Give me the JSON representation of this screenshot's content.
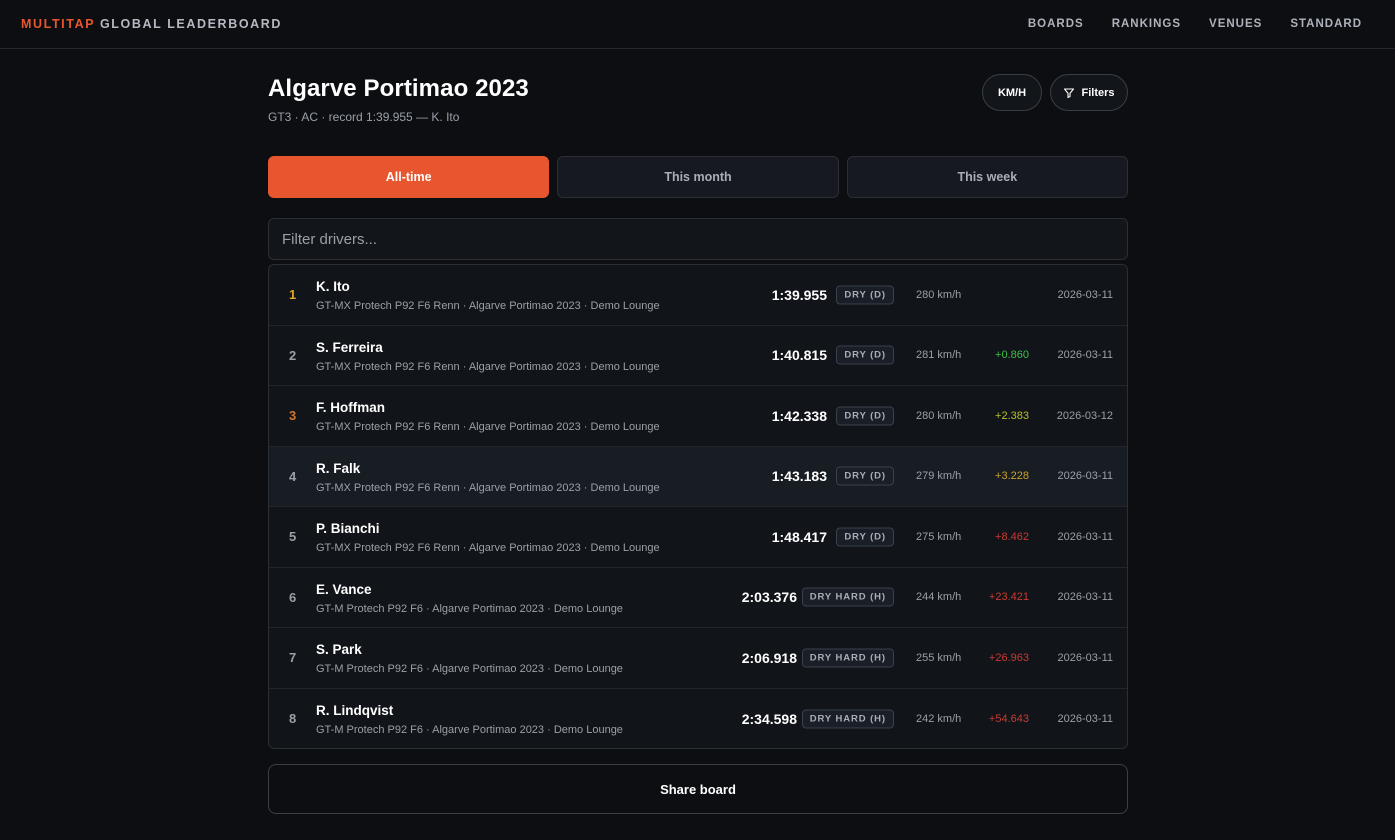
{
  "nav": {
    "brand_accent": "MULTITAP",
    "brand_rest": " GLOBAL LEADERBOARD",
    "links": [
      "BOARDS",
      "RANKINGS",
      "VENUES",
      "STANDARD"
    ]
  },
  "header": {
    "title": "Algarve Portimao 2023",
    "subtitle": "GT3 · AC · record 1:39.955 — K. Ito",
    "unit_toggle": "KM/H",
    "filters_label": "Filters"
  },
  "tabs": [
    {
      "label": "All-time",
      "active": true
    },
    {
      "label": "This month",
      "active": false
    },
    {
      "label": "This week",
      "active": false
    }
  ],
  "search": {
    "placeholder": "Filter drivers...",
    "value": ""
  },
  "rows": [
    {
      "pos": "1",
      "name": "K. Ito",
      "meta": "GT-MX Protech P92 F6 Renn · Algarve Portimao 2023 · Demo Lounge",
      "time": "1:39.955",
      "tyre": "DRY (D)",
      "speed": "280 km/h",
      "delta": "",
      "delta_color": "#9aa0a8",
      "date": "2026-03-11",
      "pos_class": "gold"
    },
    {
      "pos": "2",
      "name": "S. Ferreira",
      "meta": "GT-MX Protech P92 F6 Renn · Algarve Portimao 2023 · Demo Lounge",
      "time": "1:40.815",
      "tyre": "DRY (D)",
      "speed": "281 km/h",
      "delta": "+0.860",
      "delta_color": "#3fbf4a",
      "date": "2026-03-11",
      "pos_class": ""
    },
    {
      "pos": "3",
      "name": "F. Hoffman",
      "meta": "GT-MX Protech P92 F6 Renn · Algarve Portimao 2023 · Demo Lounge",
      "time": "1:42.338",
      "tyre": "DRY (D)",
      "speed": "280 km/h",
      "delta": "+2.383",
      "delta_color": "#b9c02a",
      "date": "2026-03-12",
      "pos_class": "bronze"
    },
    {
      "pos": "4",
      "name": "R. Falk",
      "meta": "GT-MX Protech P92 F6 Renn · Algarve Portimao 2023 · Demo Lounge",
      "time": "1:43.183",
      "tyre": "DRY (D)",
      "speed": "279 km/h",
      "delta": "+3.228",
      "delta_color": "#c9a227",
      "date": "2026-03-11",
      "pos_class": ""
    },
    {
      "pos": "5",
      "name": "P. Bianchi",
      "meta": "GT-MX Protech P92 F6 Renn · Algarve Portimao 2023 · Demo Lounge",
      "time": "1:48.417",
      "tyre": "DRY (D)",
      "speed": "275 km/h",
      "delta": "+8.462",
      "delta_color": "#c93a32",
      "date": "2026-03-11",
      "pos_class": ""
    },
    {
      "pos": "6",
      "name": "E. Vance",
      "meta": "GT-M Protech P92 F6 · Algarve Portimao 2023 · Demo Lounge",
      "time": "2:03.376",
      "tyre": "DRY HARD (H)",
      "speed": "244 km/h",
      "delta": "+23.421",
      "delta_color": "#c93a32",
      "date": "2026-03-11",
      "pos_class": ""
    },
    {
      "pos": "7",
      "name": "S. Park",
      "meta": "GT-M Protech P92 F6 · Algarve Portimao 2023 · Demo Lounge",
      "time": "2:06.918",
      "tyre": "DRY HARD (H)",
      "speed": "255 km/h",
      "delta": "+26.963",
      "delta_color": "#c93a32",
      "date": "2026-03-11",
      "pos_class": ""
    },
    {
      "pos": "8",
      "name": "R. Lindqvist",
      "meta": "GT-M Protech P92 F6 · Algarve Portimao 2023 · Demo Lounge",
      "time": "2:34.598",
      "tyre": "DRY HARD (H)",
      "speed": "242 km/h",
      "delta": "+54.643",
      "delta_color": "#c93a32",
      "date": "2026-03-11",
      "pos_class": ""
    }
  ],
  "share_label": "Share board",
  "colors": {
    "accent": "#e8562f",
    "background": "#0c0e12",
    "gold": "#e0a526",
    "bronze": "#d3772c"
  }
}
